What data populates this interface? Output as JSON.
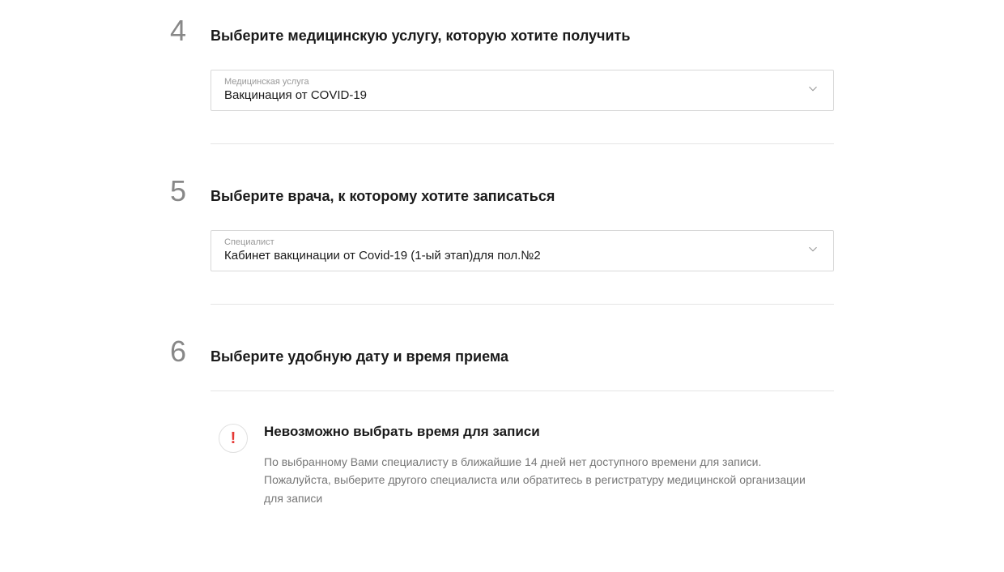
{
  "steps": {
    "step4": {
      "number": "4",
      "title": "Выберите медицинскую услугу, которую хотите получить",
      "field": {
        "label": "Медицинская услуга",
        "value": "Вакцинация от COVID-19"
      }
    },
    "step5": {
      "number": "5",
      "title": "Выберите врача, к которому хотите записаться",
      "field": {
        "label": "Специалист",
        "value": "Кабинет вакцинации от Covid-19 (1-ый этап)для пол.№2"
      }
    },
    "step6": {
      "number": "6",
      "title": "Выберите удобную дату и время приема",
      "alert": {
        "title": "Невозможно выбрать время для записи",
        "text": "По выбранному Вами специалисту в ближайшие 14 дней нет доступного времени для записи. Пожалуйста, выберите другого специалиста или обратитесь в регистратуру медицинской организации для записи"
      }
    }
  }
}
